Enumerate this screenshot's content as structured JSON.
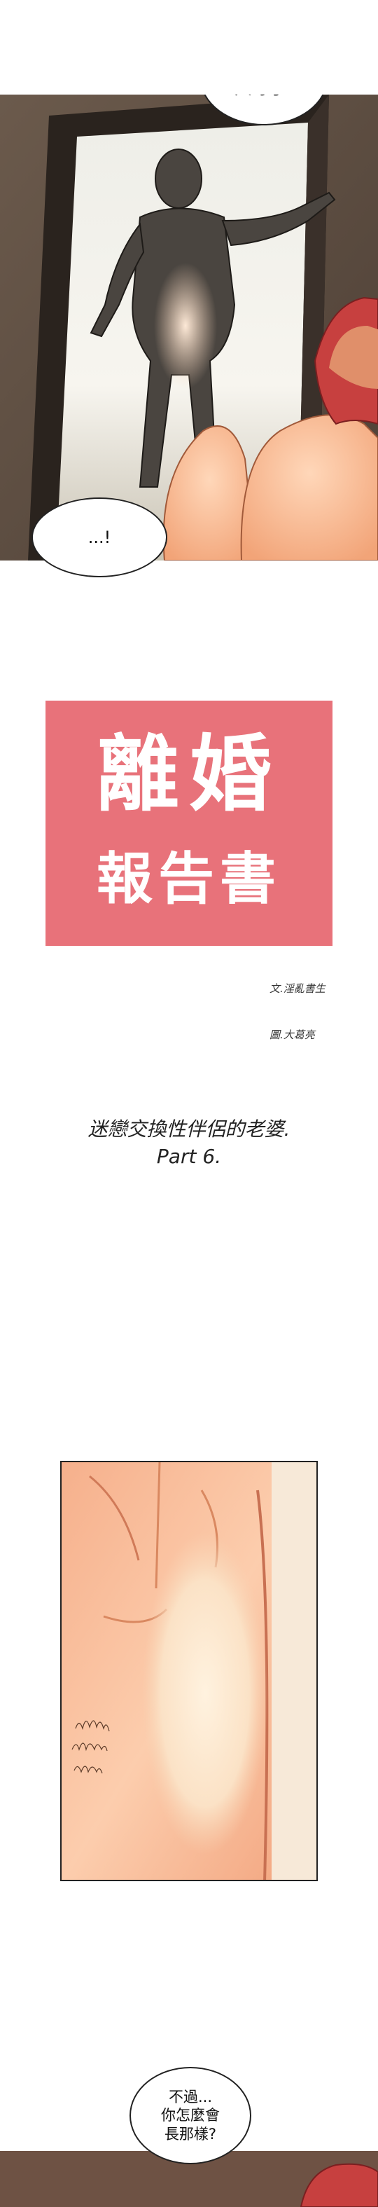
{
  "panel1": {
    "bubble_top": "讓你\n久等了!",
    "bubble_bottom": "...!"
  },
  "title": {
    "line1": "離婚",
    "line2": "報告書"
  },
  "credits": {
    "writer": "文.淫亂書生",
    "artist": "圖.大葛亮"
  },
  "subtitle": {
    "line1": "迷戀交換性伴侶的老婆.",
    "line2": "Part 6."
  },
  "panel3": {
    "bubble": "不過...\n你怎麼會\n長那樣?"
  }
}
